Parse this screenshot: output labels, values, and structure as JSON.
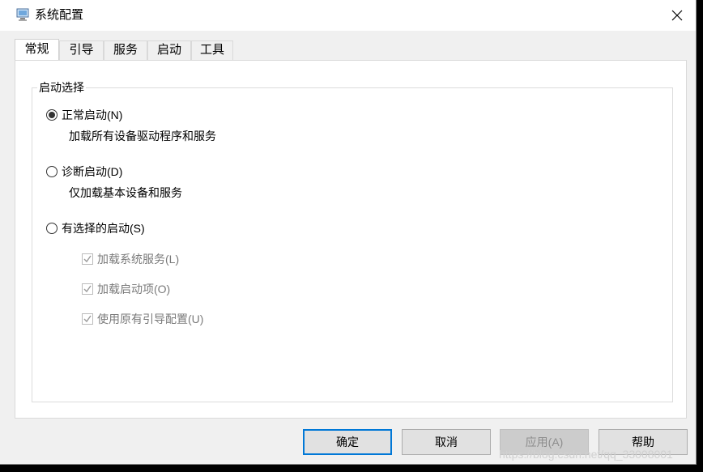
{
  "window": {
    "title": "系统配置",
    "app_icon": "msconfig-icon",
    "close_icon": "close-icon"
  },
  "tabs": [
    {
      "label": "常规",
      "active": true
    },
    {
      "label": "引导",
      "active": false
    },
    {
      "label": "服务",
      "active": false
    },
    {
      "label": "启动",
      "active": false
    },
    {
      "label": "工具",
      "active": false
    }
  ],
  "startup_group": {
    "legend": "启动选择",
    "options": [
      {
        "label": "正常启动(N)",
        "description": "加载所有设备驱动程序和服务",
        "checked": true
      },
      {
        "label": "诊断启动(D)",
        "description": "仅加载基本设备和服务",
        "checked": false
      },
      {
        "label": "有选择的启动(S)",
        "checked": false
      }
    ],
    "selective_items": [
      {
        "label": "加载系统服务(L)",
        "checked": true,
        "enabled": false
      },
      {
        "label": "加载启动项(O)",
        "checked": true,
        "enabled": false
      },
      {
        "label": "使用原有引导配置(U)",
        "checked": true,
        "enabled": false
      }
    ]
  },
  "buttons": {
    "ok": "确定",
    "cancel": "取消",
    "apply": "应用(A)",
    "help": "帮助"
  },
  "watermark": "https://blog.csdn.net/qq_33008001"
}
